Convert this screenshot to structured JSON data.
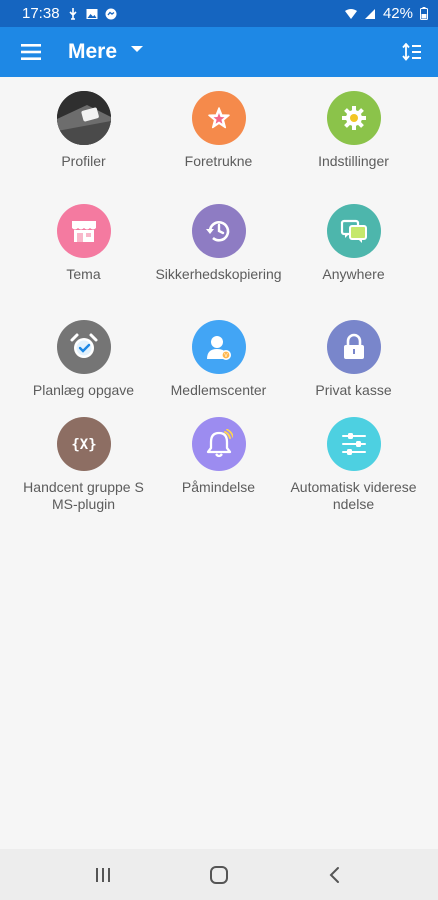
{
  "status_bar": {
    "time": "17:38",
    "battery": "42%",
    "icons": [
      "usb-icon",
      "image-icon",
      "messenger-icon",
      "wifi-icon",
      "signal-icon",
      "battery-icon"
    ]
  },
  "app_bar": {
    "title": "Mere",
    "menu_icon": "hamburger-icon",
    "sort_icon": "sort-icon"
  },
  "grid": {
    "items": [
      {
        "label": "Profiler",
        "icon": "profile-photo-icon",
        "color": "#3a3a3a"
      },
      {
        "label": "Foretrukne",
        "icon": "star-icon",
        "color": "#f58a4b"
      },
      {
        "label": "Indstillinger",
        "icon": "gear-icon",
        "color": "#8bc34a"
      },
      {
        "label": "Tema",
        "icon": "store-icon",
        "color": "#f47aa0"
      },
      {
        "label": "Sikkerhedskopiering",
        "icon": "backup-history-icon",
        "color": "#8e7cc3"
      },
      {
        "label": "Anywhere",
        "icon": "chat-screens-icon",
        "color": "#4db6ac"
      },
      {
        "label": "Planlæg opgave",
        "icon": "alarm-clock-icon",
        "color": "#757575"
      },
      {
        "label": "Medlemscenter",
        "icon": "member-badge-icon",
        "color": "#42a5f5"
      },
      {
        "label": "Privat kasse",
        "icon": "lock-icon",
        "color": "#7986cb"
      },
      {
        "label": "Handcent gruppe SMS-plugin",
        "icon": "code-braces-icon",
        "color": "#8d6e63"
      },
      {
        "label": "Påmindelse",
        "icon": "bell-icon",
        "color": "#9c8cf0"
      },
      {
        "label": "Automatisk videresendelse",
        "icon": "sliders-icon",
        "color": "#4dd0e1"
      }
    ]
  },
  "nav_bar": {
    "recent_icon": "recent-apps-icon",
    "home_icon": "home-icon",
    "back_icon": "back-icon"
  }
}
